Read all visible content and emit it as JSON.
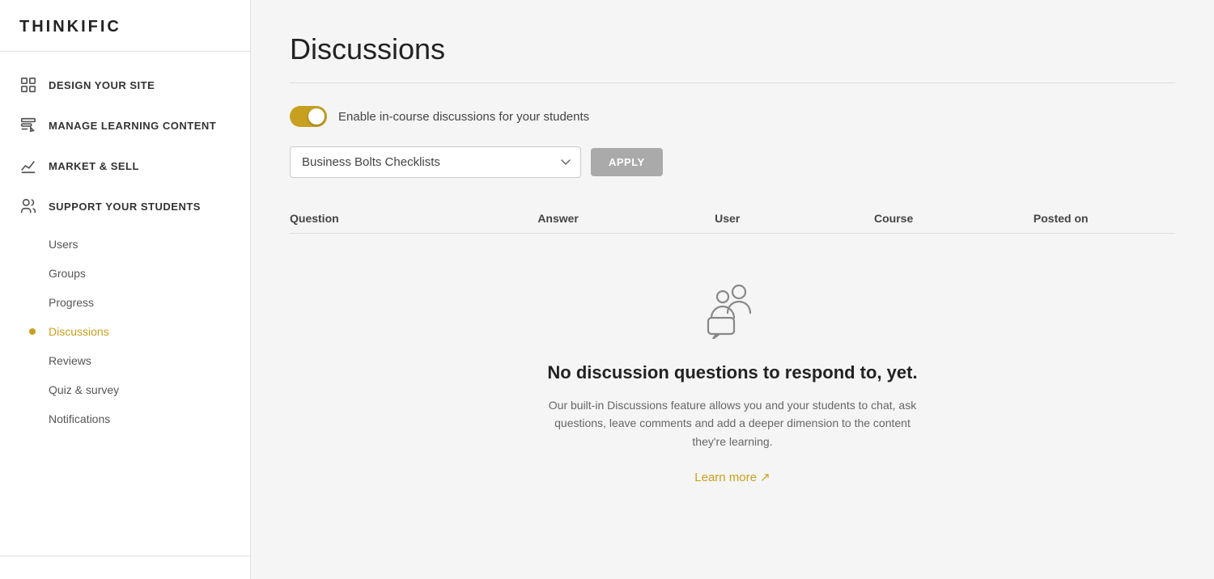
{
  "app": {
    "name": "THINKIFIC"
  },
  "sidebar": {
    "nav_items": [
      {
        "id": "design",
        "label": "DESIGN YOUR SITE",
        "icon": "grid-icon"
      },
      {
        "id": "manage",
        "label": "MANAGE LEARNING CONTENT",
        "icon": "edit-icon"
      },
      {
        "id": "market",
        "label": "MARKET & SELL",
        "icon": "chart-icon"
      },
      {
        "id": "support",
        "label": "SUPPORT YOUR STUDENTS",
        "icon": "users-icon",
        "sub_items": [
          {
            "id": "users",
            "label": "Users",
            "active": false
          },
          {
            "id": "groups",
            "label": "Groups",
            "active": false
          },
          {
            "id": "progress",
            "label": "Progress",
            "active": false
          },
          {
            "id": "discussions",
            "label": "Discussions",
            "active": true
          },
          {
            "id": "reviews",
            "label": "Reviews",
            "active": false
          },
          {
            "id": "quiz-survey",
            "label": "Quiz & survey",
            "active": false
          },
          {
            "id": "notifications",
            "label": "Notifications",
            "active": false
          }
        ]
      }
    ]
  },
  "main": {
    "page_title": "Discussions",
    "toggle_label": "Enable in-course discussions for your students",
    "toggle_enabled": true,
    "course_select": {
      "selected": "Business Bolts Checklists",
      "options": [
        "Business Bolts Checklists"
      ]
    },
    "apply_button": "APPLY",
    "table": {
      "columns": [
        {
          "id": "question",
          "label": "Question"
        },
        {
          "id": "answer",
          "label": "Answer"
        },
        {
          "id": "user",
          "label": "User"
        },
        {
          "id": "course",
          "label": "Course"
        },
        {
          "id": "posted_on",
          "label": "Posted on"
        }
      ]
    },
    "empty_state": {
      "title": "No discussion questions to respond to, yet.",
      "description": "Our built-in Discussions feature allows you and your students to chat, ask questions, leave comments and add a deeper dimension to the content they're learning.",
      "learn_more": "Learn more",
      "learn_more_arrow": "↗"
    }
  }
}
